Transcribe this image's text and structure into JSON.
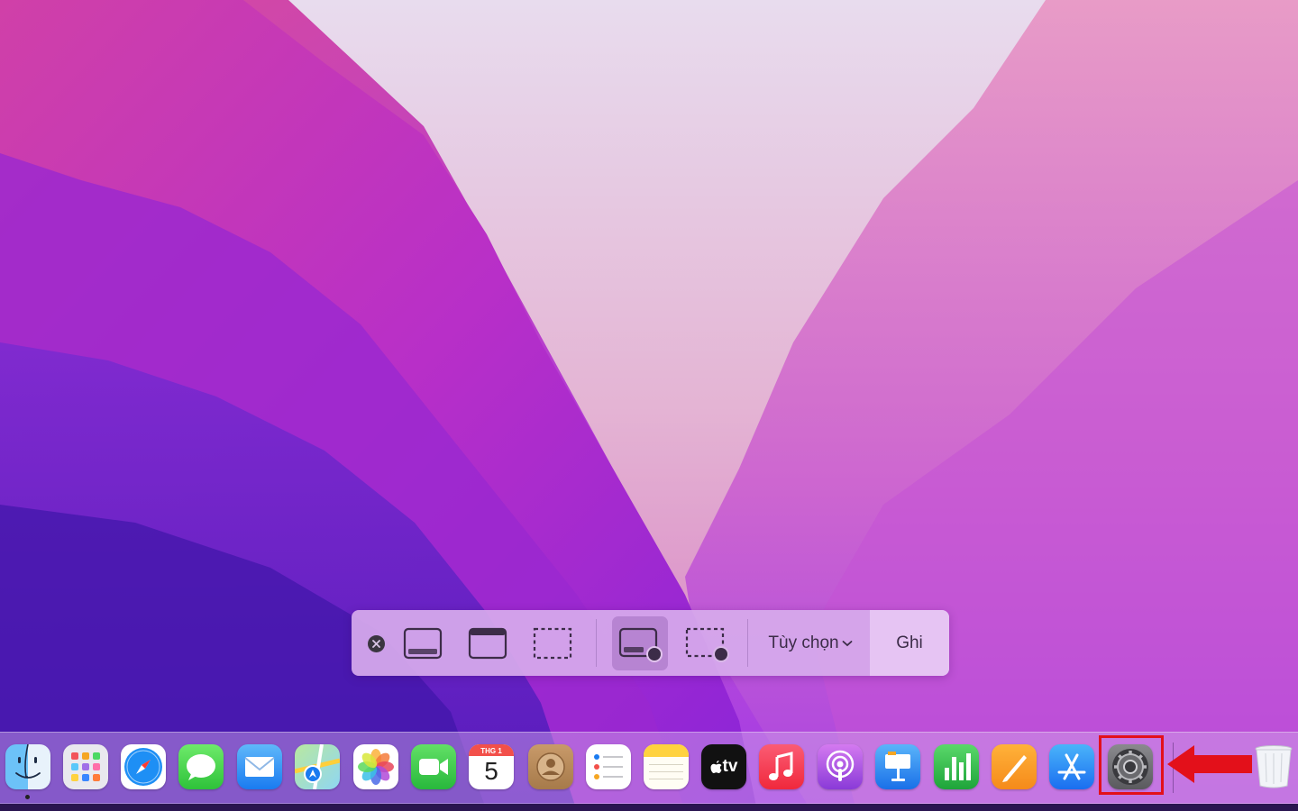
{
  "screenshot_toolbar": {
    "close_label": "Close",
    "options_label": "Tùy chọn",
    "record_label": "Ghi"
  },
  "dock": {
    "apps": [
      {
        "name": "Finder",
        "icon": "finder-icon",
        "running": true
      },
      {
        "name": "Launchpad",
        "icon": "launchpad-icon"
      },
      {
        "name": "Safari",
        "icon": "safari-icon"
      },
      {
        "name": "Messages",
        "icon": "messages-icon"
      },
      {
        "name": "Mail",
        "icon": "mail-icon"
      },
      {
        "name": "Maps",
        "icon": "maps-icon"
      },
      {
        "name": "Photos",
        "icon": "photos-icon"
      },
      {
        "name": "FaceTime",
        "icon": "facetime-icon"
      },
      {
        "name": "Calendar",
        "icon": "calendar-icon"
      },
      {
        "name": "Contacts",
        "icon": "contacts-icon"
      },
      {
        "name": "Reminders",
        "icon": "reminders-icon"
      },
      {
        "name": "Notes",
        "icon": "notes-icon"
      },
      {
        "name": "TV",
        "icon": "apple-tv-icon"
      },
      {
        "name": "Music",
        "icon": "music-icon"
      },
      {
        "name": "Podcasts",
        "icon": "podcasts-icon"
      },
      {
        "name": "Keynote",
        "icon": "keynote-icon"
      },
      {
        "name": "Numbers",
        "icon": "numbers-icon"
      },
      {
        "name": "Pages",
        "icon": "pages-icon"
      },
      {
        "name": "App Store",
        "icon": "app-store-icon"
      },
      {
        "name": "System Preferences",
        "icon": "system-preferences-icon"
      },
      {
        "name": "Trash",
        "icon": "trash-icon"
      }
    ],
    "calendar": {
      "month": "THG 1",
      "day": "5"
    },
    "tv_label": "tv"
  },
  "annotation": {
    "highlight_color": "#e3101a",
    "target": "system-preferences-icon"
  }
}
